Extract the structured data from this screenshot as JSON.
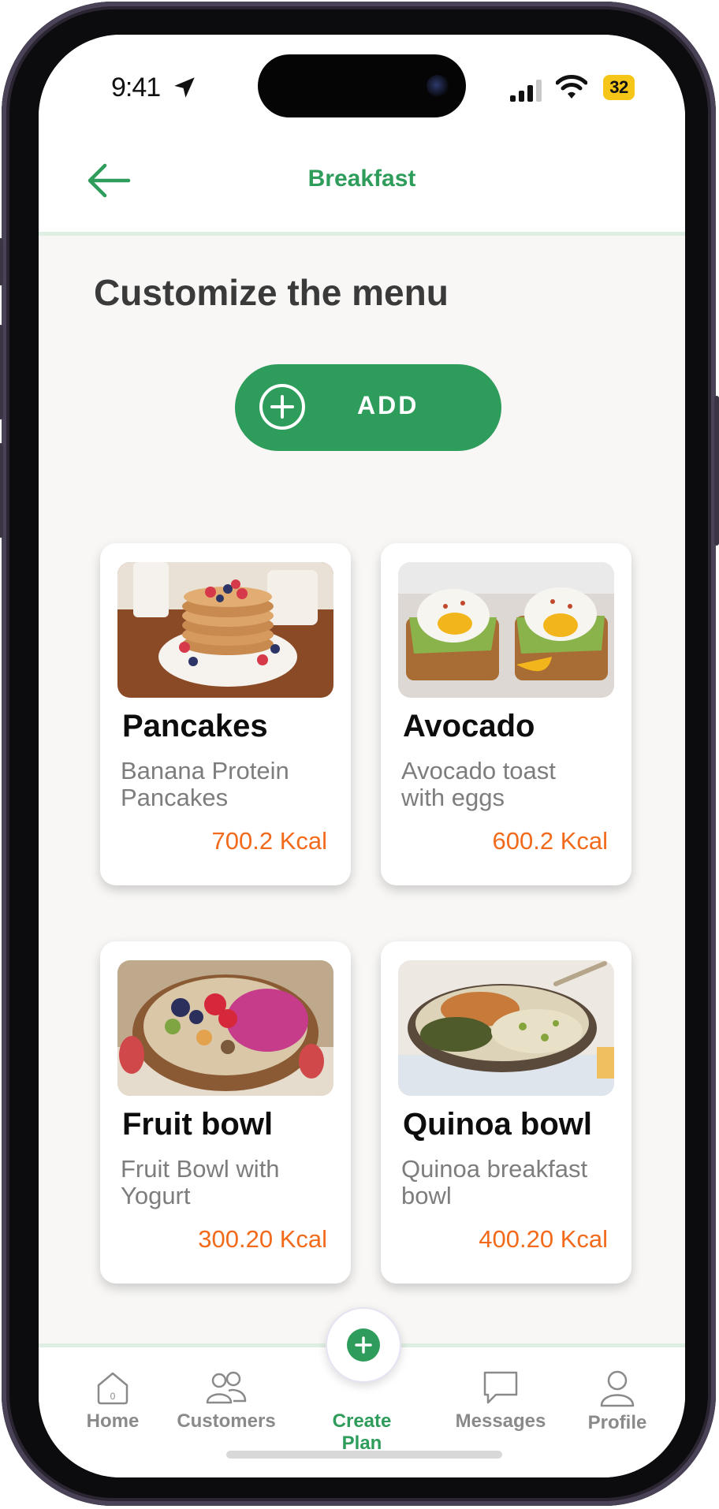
{
  "status_bar": {
    "time": "9:41",
    "battery": "32",
    "icons": [
      "location-arrow-icon",
      "signal-icon",
      "wifi-icon",
      "battery-icon"
    ]
  },
  "header": {
    "title": "Breakfast",
    "back_icon": "arrow-left-icon"
  },
  "main": {
    "heading": "Customize the menu",
    "add_button": {
      "label": "ADD",
      "icon": "plus-circle-icon"
    },
    "cards": [
      {
        "title": "Pancakes",
        "description": "Banana  Protein\nPancakes",
        "kcal": "700.2 Kcal"
      },
      {
        "title": "Avocado",
        "description": "Avocado toast\nwith eggs",
        "kcal": "600.2 Kcal"
      },
      {
        "title": "Fruit bowl",
        "description": "Fruit Bowl with\nYogurt",
        "kcal": "300.20 Kcal"
      },
      {
        "title": "Quinoa bowl",
        "description": "Quinoa breakfast\nbowl",
        "kcal": "400.20 Kcal"
      }
    ]
  },
  "tabbar": {
    "items": [
      {
        "label": "Home",
        "icon": "home-icon"
      },
      {
        "label": "Customers",
        "icon": "users-icon"
      },
      {
        "label": "Create Plan",
        "icon": "plus-icon",
        "active": true
      },
      {
        "label": "Messages",
        "icon": "chat-icon"
      },
      {
        "label": "Profile",
        "icon": "user-icon"
      }
    ]
  },
  "colors": {
    "accent": "#2e9c5a",
    "kcal": "#f26a1b",
    "heading": "#3a3a3a",
    "background": "#f8f7f5"
  }
}
